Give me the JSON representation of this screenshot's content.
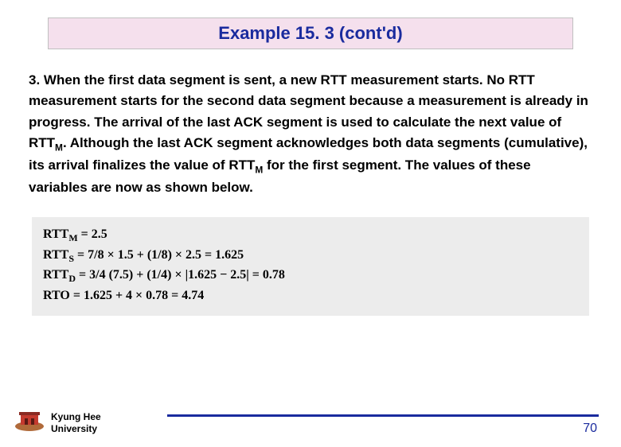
{
  "title": "Example 15. 3 (cont'd)",
  "paragraph": {
    "num": "3.",
    "text_parts": [
      "When the first data segment is sent, a new RTT measurement starts. No RTT measurement starts for the second data segment because a measurement is already in progress. The arrival of the last ACK segment is used to calculate the next value of RTT",
      ". Although the last ACK segment acknowledges both data segments (cumulative), its arrival finalizes the value of RTT",
      " for the first segment. The values of these variables are now as shown below."
    ],
    "sub1": "M",
    "sub2": "M"
  },
  "calc": {
    "l1_label": "RTT",
    "l1_sub": "M",
    "l1_rest": " = 2.5",
    "l2_label": "RTT",
    "l2_sub": "S",
    "l2_rest": " = 7/8 × 1.5 + (1/8) × 2.5 = 1.625",
    "l3_label": "RTT",
    "l3_sub": "D",
    "l3_rest": " = 3/4 (7.5) + (1/4) × |1.625 − 2.5| = 0.78",
    "l4": "RTO   = 1.625 + 4 × 0.78 = 4.74"
  },
  "footer": {
    "uni_line1": "Kyung Hee",
    "uni_line2": "University",
    "page": "70"
  }
}
